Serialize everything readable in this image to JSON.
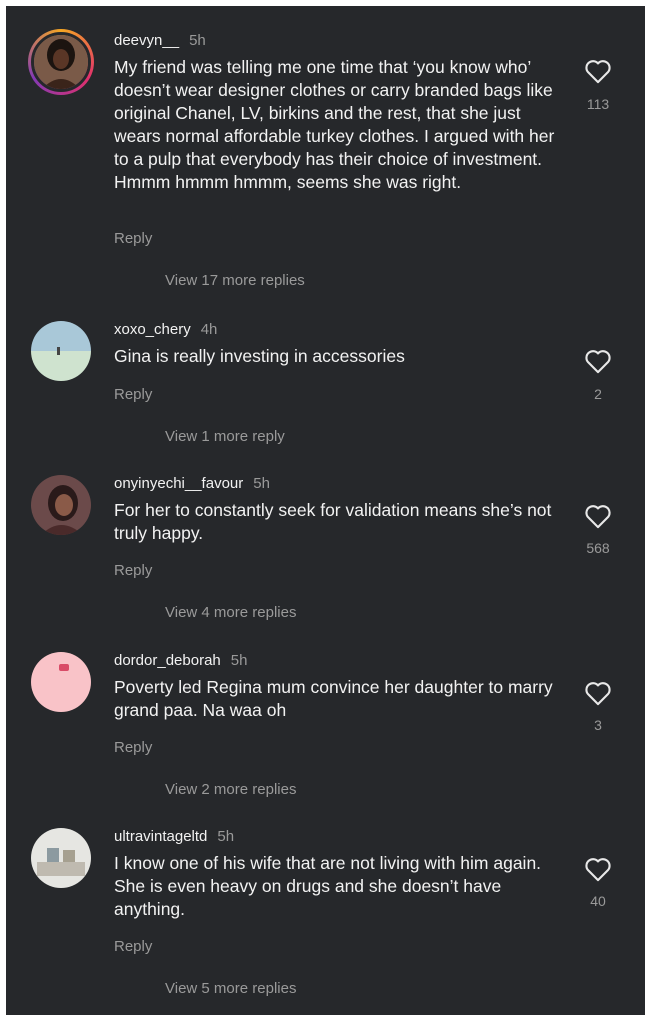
{
  "comments": [
    {
      "username": "deevyn__",
      "time": "5h",
      "text": "My friend was telling me one time that ‘you know who’ doesn’t wear designer clothes or carry branded bags like original Chanel, LV, birkins and the rest, that she just wears normal affordable turkey clothes. I argued with her to a pulp that everybody has their choice of investment. Hmmm hmmm hmmm, seems she was right.",
      "reply_label": "Reply",
      "view_replies": "View 17 more replies",
      "likes": "113"
    },
    {
      "username": "xoxo_chery",
      "time": "4h",
      "text": "Gina is really investing in accessories",
      "reply_label": "Reply",
      "view_replies": "View 1 more reply",
      "likes": "2"
    },
    {
      "username": "onyinyechi__favour",
      "time": "5h",
      "text": "For her to constantly seek for validation means she’s not truly happy.",
      "reply_label": "Reply",
      "view_replies": "View 4 more replies",
      "likes": "568"
    },
    {
      "username": "dordor_deborah",
      "time": "5h",
      "text": "Poverty led Regina mum convince her daughter to marry grand paa. Na waa oh",
      "reply_label": "Reply",
      "view_replies": "View 2 more replies",
      "likes": "3"
    },
    {
      "username": "ultravintageltd",
      "time": "5h",
      "text": "I know one of his wife that are not living with him again. She is even heavy on drugs and she doesn’t have anything.",
      "reply_label": "Reply",
      "view_replies": "View 5 more replies",
      "likes": "40"
    }
  ],
  "icons": {
    "like": "heart-outline-icon"
  },
  "colors": {
    "background": "#26282b",
    "text": "#f2f2f2",
    "muted": "#9a9a9a"
  }
}
